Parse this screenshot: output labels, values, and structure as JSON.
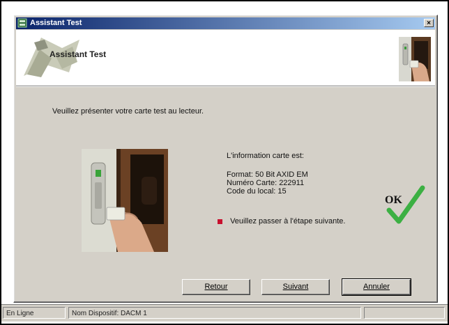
{
  "window": {
    "title": "Assistant Test",
    "close_glyph": "×"
  },
  "header": {
    "title": "Assistant Test"
  },
  "content": {
    "instruction": "Veuillez présenter votre carte test au lecteur.",
    "info_heading": "L'information carte est:",
    "info_lines": [
      "Format: 50 Bit AXID EM",
      "Numéro Carte: 222911",
      "Code du local: 15"
    ],
    "next_step": "Veuillez passer à l'étape suivante.",
    "ok_label": "OK",
    "accent_red": "#c8102e",
    "check_green": "#3cb043"
  },
  "buttons": {
    "back": "Retour",
    "next": "Suivant",
    "cancel": "Annuler"
  },
  "status_bar": {
    "state": "En Ligne",
    "device": "Nom Dispositif: DACM 1",
    "empty": ""
  },
  "icons": [
    "app-icon",
    "close-icon",
    "wizard-art-icon",
    "card-reader-photo",
    "ok-check-icon"
  ]
}
